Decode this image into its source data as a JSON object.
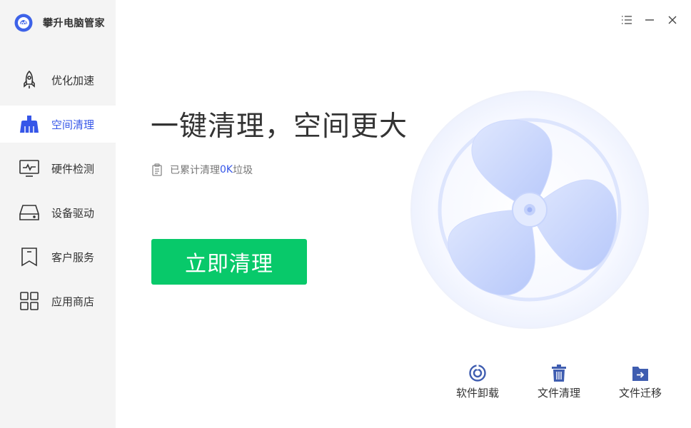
{
  "app": {
    "name": "攀升电脑管家"
  },
  "sidebar": {
    "items": [
      {
        "label": "优化加速",
        "icon": "rocket-icon",
        "active": false
      },
      {
        "label": "空间清理",
        "icon": "broom-icon",
        "active": true
      },
      {
        "label": "硬件检测",
        "icon": "monitor-icon",
        "active": false
      },
      {
        "label": "设备驱动",
        "icon": "hard-drive-icon",
        "active": false
      },
      {
        "label": "客户服务",
        "icon": "bookmark-icon",
        "active": false
      },
      {
        "label": "应用商店",
        "icon": "app-grid-icon",
        "active": false
      }
    ]
  },
  "window_controls": {
    "menu": "menu-icon",
    "minimize": "minimize-icon",
    "close": "close-icon"
  },
  "main": {
    "headline": "一键清理，空间更大",
    "stat_prefix": "已累计清理",
    "stat_value": "0K",
    "stat_suffix": "垃圾",
    "clean_button": "立即清理"
  },
  "tools": [
    {
      "label": "软件卸载",
      "icon": "uninstall-icon"
    },
    {
      "label": "文件清理",
      "icon": "trash-icon"
    },
    {
      "label": "文件迁移",
      "icon": "folder-migrate-icon"
    }
  ],
  "colors": {
    "accent": "#3656e8",
    "button": "#08c96a",
    "sidebar_bg": "#f4f4f4",
    "fan": "#c9d6fb"
  }
}
